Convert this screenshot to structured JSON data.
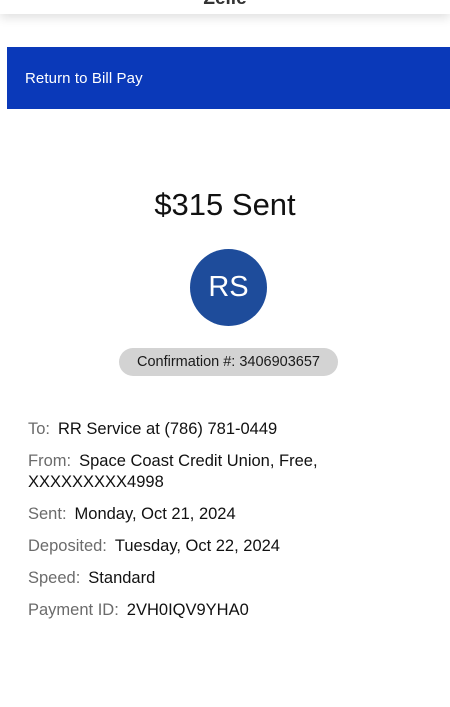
{
  "header": {
    "title": "Zelle"
  },
  "nav": {
    "return_label": "Return to Bill Pay"
  },
  "payment": {
    "sent_title": "$315 Sent",
    "avatar_initials": "RS",
    "confirmation_text": "Confirmation #: 3406903657"
  },
  "details": {
    "to_label": "To:",
    "to_value": "RR Service at (786) 781-0449",
    "from_label": "From:",
    "from_value": "Space Coast Credit Union, Free, XXXXXXXXX4998",
    "sent_label": "Sent:",
    "sent_value": "Monday, Oct 21, 2024",
    "deposited_label": "Deposited:",
    "deposited_value": "Tuesday, Oct 22, 2024",
    "speed_label": "Speed:",
    "speed_value": "Standard",
    "payment_id_label": "Payment ID:",
    "payment_id_value": "2VH0IQV9YHA0"
  },
  "colors": {
    "brand_blue": "#0a39b9",
    "avatar_blue": "#1e4c9b",
    "pill_gray": "#d3d3d3",
    "label_gray": "#6b6b6b"
  }
}
